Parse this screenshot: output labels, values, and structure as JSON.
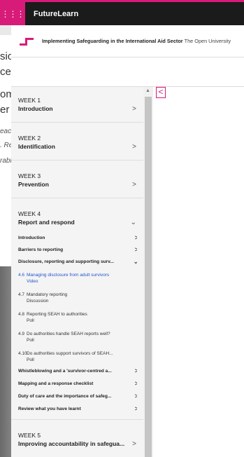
{
  "app": {
    "brand": "FutureLearn"
  },
  "course": {
    "title": "Implementing Safeguarding in the International Aid Sector",
    "provider": "The Open University"
  },
  "background_text": [
    "sio",
    "ce a",
    "om",
    "er l",
    "eac",
    ". Re",
    "rabl"
  ],
  "toggle": {
    "collapse_symbol": "<"
  },
  "weeks": [
    {
      "label": "WEEK 1",
      "title": "Introduction"
    },
    {
      "label": "WEEK 2",
      "title": "Identification"
    },
    {
      "label": "WEEK 3",
      "title": "Prevention"
    },
    {
      "label": "WEEK 4",
      "title": "Report and respond"
    },
    {
      "label": "WEEK 5",
      "title": "Improving accountability in safegua..."
    }
  ],
  "week4_sections": [
    "Introduction",
    "Barriers to reporting",
    "Disclosure, reporting and supporting surv...",
    "Whistleblowing and a 'survivor-centred a...",
    "Mapping and a response checklist",
    "Duty of care and the importance of safeg...",
    "Review what you have learnt"
  ],
  "steps": [
    {
      "num": "4.6",
      "title": "Managing disclosure from adult survivors",
      "type": "Video"
    },
    {
      "num": "4.7",
      "title": "Mandatory reporting",
      "type": "Discussion"
    },
    {
      "num": "4.8",
      "title": "Reporting SEAH to authorities",
      "type": "Poll"
    },
    {
      "num": "4.9",
      "title": "Do authorities handle SEAH reports well?",
      "type": "Poll"
    },
    {
      "num": "4.10",
      "title": "Do authorities support survivors of SEAH...",
      "type": "Poll"
    }
  ]
}
